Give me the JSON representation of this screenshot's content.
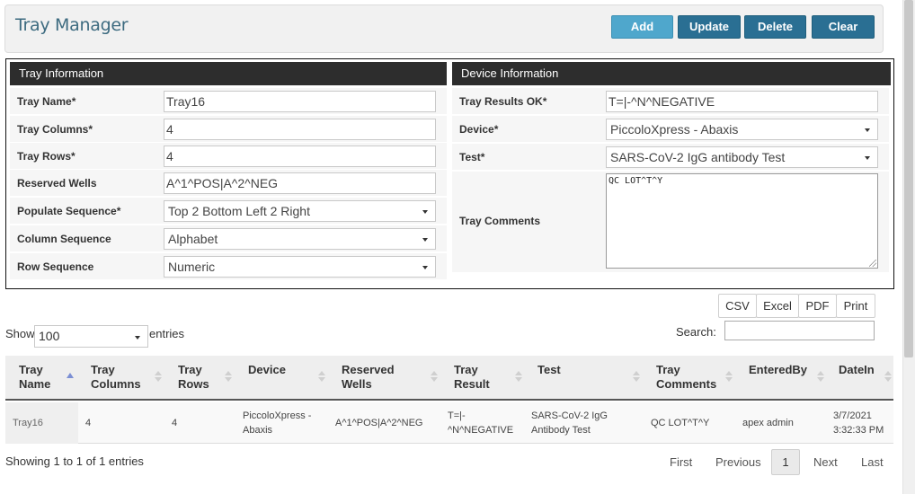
{
  "header": {
    "title": "Tray Manager",
    "buttons": {
      "add": "Add",
      "update": "Update",
      "delete": "Delete",
      "clear": "Clear"
    }
  },
  "tray_info": {
    "heading": "Tray Information",
    "tray_name": {
      "label": "Tray Name*",
      "value": "Tray16"
    },
    "tray_columns": {
      "label": "Tray Columns*",
      "value": "4"
    },
    "tray_rows": {
      "label": "Tray Rows*",
      "value": "4"
    },
    "reserved_wells": {
      "label": "Reserved Wells",
      "value": "A^1^POS|A^2^NEG"
    },
    "populate_sequence": {
      "label": "Populate Sequence*",
      "value": "Top 2 Bottom Left 2 Right"
    },
    "column_sequence": {
      "label": "Column Sequence",
      "value": "Alphabet"
    },
    "row_sequence": {
      "label": "Row Sequence",
      "value": "Numeric"
    }
  },
  "device_info": {
    "heading": "Device Information",
    "tray_results_ok": {
      "label": "Tray Results OK*",
      "value": "T=|-^N^NEGATIVE"
    },
    "device": {
      "label": "Device*",
      "value": "PiccoloXpress - Abaxis"
    },
    "test": {
      "label": "Test*",
      "value": "SARS-CoV-2 IgG antibody Test"
    },
    "tray_comments": {
      "label": "Tray Comments",
      "value": "QC LOT^T^Y"
    }
  },
  "export_buttons": {
    "csv": "CSV",
    "excel": "Excel",
    "pdf": "PDF",
    "print": "Print"
  },
  "table_controls": {
    "show_label": "Show",
    "page_length": "100",
    "entries_label": "entries",
    "search_label": "Search:",
    "search_value": ""
  },
  "table": {
    "headers": [
      {
        "line1": "Tray",
        "line2": "Name"
      },
      {
        "line1": "Tray",
        "line2": "Columns"
      },
      {
        "line1": "Tray",
        "line2": "Rows"
      },
      {
        "line1": "Device",
        "line2": ""
      },
      {
        "line1": "Reserved",
        "line2": "Wells"
      },
      {
        "line1": "Tray",
        "line2": "Result"
      },
      {
        "line1": "Test",
        "line2": ""
      },
      {
        "line1": "Tray",
        "line2": "Comments"
      },
      {
        "line1": "EnteredBy",
        "line2": ""
      },
      {
        "line1": "DateIn",
        "line2": ""
      }
    ],
    "rows": [
      {
        "tray_name": "Tray16",
        "tray_columns": "4",
        "tray_rows": "4",
        "device_l1": "PiccoloXpress -",
        "device_l2": "Abaxis",
        "reserved_wells": "A^1^POS|A^2^NEG",
        "tray_result_l1": "T=|-",
        "tray_result_l2": "^N^NEGATIVE",
        "test_l1": "SARS-CoV-2 IgG",
        "test_l2": "Antibody Test",
        "tray_comments": "QC LOT^T^Y",
        "entered_by": "apex admin",
        "date_l1": "3/7/2021",
        "date_l2": "3:32:33 PM"
      }
    ]
  },
  "footer": {
    "info": "Showing 1 to 1 of 1 entries",
    "pagination": {
      "first": "First",
      "previous": "Previous",
      "current": "1",
      "next": "Next",
      "last": "Last"
    }
  }
}
